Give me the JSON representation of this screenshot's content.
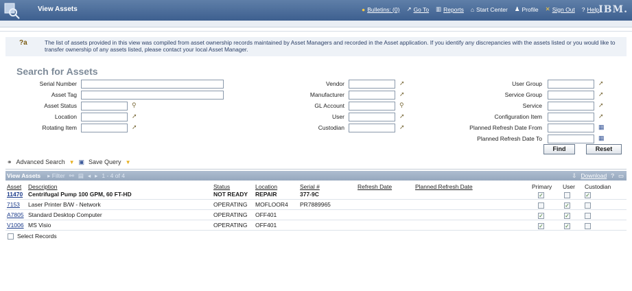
{
  "header": {
    "title": "View Assets",
    "nav": [
      {
        "label": "Bulletins: (0)",
        "icon": "bulletin-icon"
      },
      {
        "label": "Go To",
        "icon": "goto-icon"
      },
      {
        "label": "Reports",
        "icon": "reports-icon"
      },
      {
        "label": "Start Center",
        "icon": "home-icon"
      },
      {
        "label": "Profile",
        "icon": "profile-icon"
      },
      {
        "label": "Sign Out",
        "icon": "signout-icon"
      },
      {
        "label": "Help",
        "icon": "help-icon"
      }
    ],
    "brand": "IBM."
  },
  "info": {
    "text": "The list of assets provided in this view was compiled from asset ownership records maintained by Asset Managers and recorded in the Asset application. If you identify any discrepancies with the assets listed or you would like to transfer ownership of any assets listed, please contact your local Asset Manager."
  },
  "search": {
    "title": "Search for Assets",
    "col1": [
      {
        "label": "Serial Number"
      },
      {
        "label": "Asset Tag"
      },
      {
        "label": "Asset Status"
      },
      {
        "label": "Location"
      },
      {
        "label": "Rotating Item"
      }
    ],
    "col2": [
      {
        "label": "Vendor"
      },
      {
        "label": "Manufacturer"
      },
      {
        "label": "GL Account"
      },
      {
        "label": "User"
      },
      {
        "label": "Custodian"
      }
    ],
    "col3": [
      {
        "label": "User Group"
      },
      {
        "label": "Service Group"
      },
      {
        "label": "Service"
      },
      {
        "label": "Configuration Item"
      },
      {
        "label": "Planned Refresh Date From"
      },
      {
        "label": "Planned Refresh Date To"
      }
    ],
    "find_label": "Find",
    "reset_label": "Reset"
  },
  "toolbar": {
    "advanced_search": "Advanced Search",
    "save_query": "Save Query"
  },
  "table": {
    "title": "View Assets",
    "filter_label": "Filter",
    "paging": "1 - 4 of 4",
    "download_label": "Download",
    "columns": [
      "Asset",
      "Description",
      "Status",
      "Location",
      "Serial #",
      "Refresh Date",
      "Planned Refresh Date",
      "Primary",
      "User",
      "Custodian"
    ],
    "rows": [
      {
        "asset": "11470",
        "description": "Centrifugal Pump 100 GPM, 60 FT-HD",
        "status": "NOT READY",
        "location": "REPAIR",
        "serial": "377-9C",
        "primary": true,
        "user": false,
        "custodian": true
      },
      {
        "asset": "7153",
        "description": "Laser Printer B/W - Network",
        "status": "OPERATING",
        "location": "MOFLOOR4",
        "serial": "PR7889965",
        "primary": false,
        "user": true,
        "custodian": false
      },
      {
        "asset": "A7805",
        "description": "Standard Desktop Computer",
        "status": "OPERATING",
        "location": "OFF401",
        "serial": "",
        "primary": true,
        "user": true,
        "custodian": false
      },
      {
        "asset": "V1006",
        "description": "MS Visio",
        "status": "OPERATING",
        "location": "OFF401",
        "serial": "",
        "primary": true,
        "user": true,
        "custodian": false
      }
    ],
    "select_records": "Select Records"
  }
}
